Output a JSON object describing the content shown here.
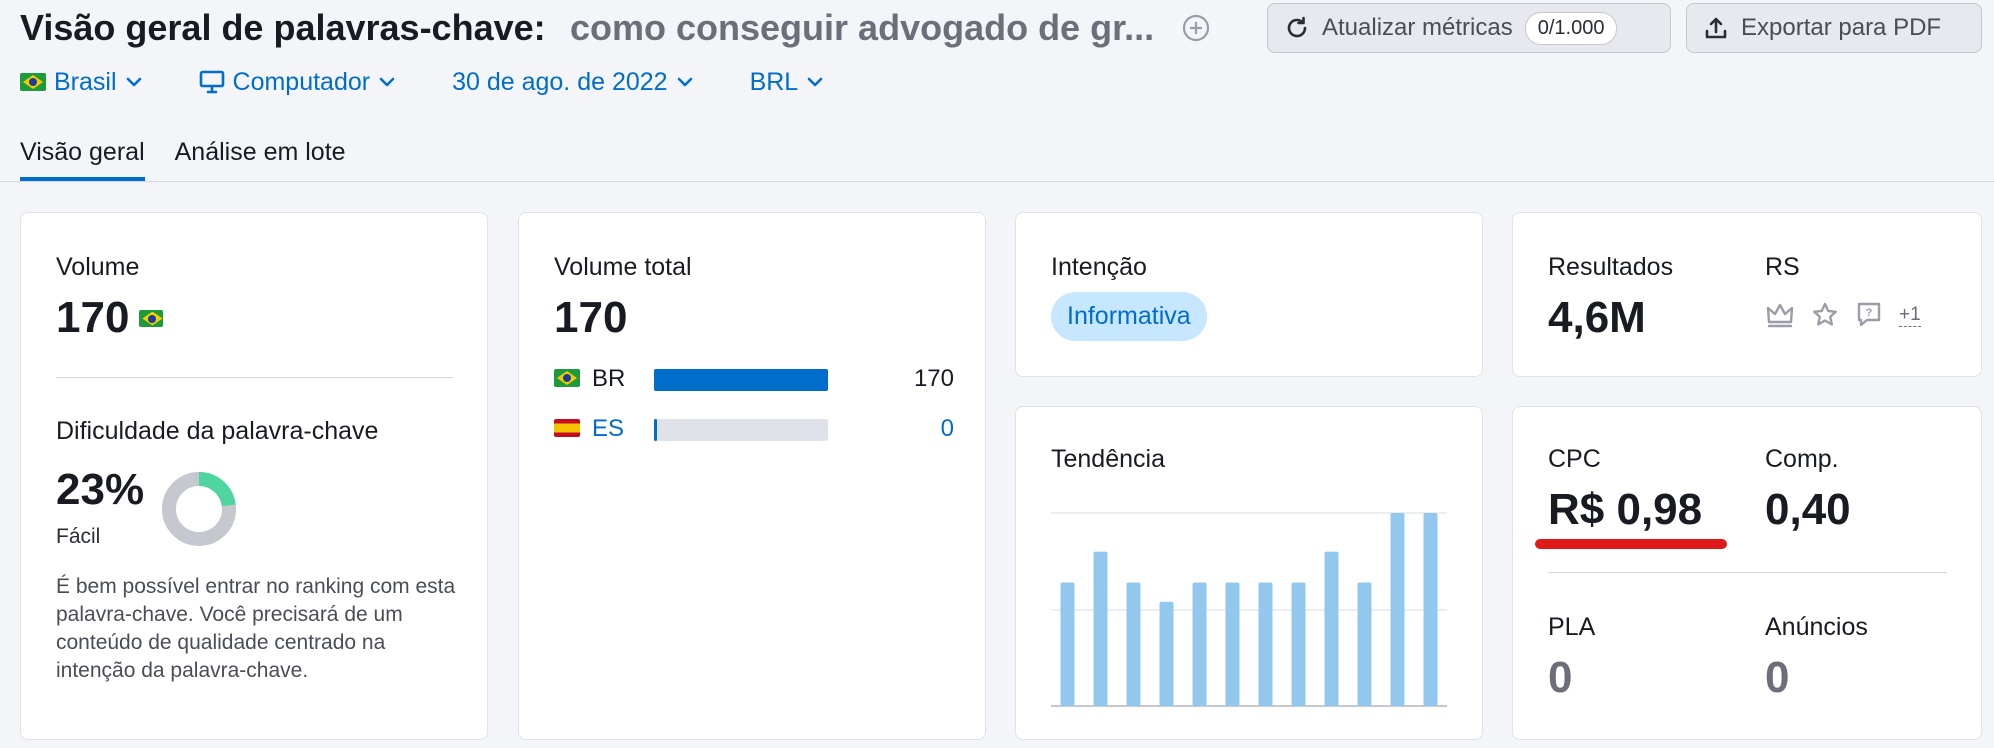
{
  "header": {
    "title": "Visão geral de palavras-chave:",
    "keyword": "como conseguir advogado de gr...",
    "refresh_label": "Atualizar métricas",
    "refresh_count": "0/1.000",
    "export_label": "Exportar para PDF"
  },
  "filters": {
    "country": "Brasil",
    "device": "Computador",
    "date": "30 de ago. de 2022",
    "currency": "BRL"
  },
  "tabs": [
    {
      "label": "Visão geral",
      "active": true
    },
    {
      "label": "Análise em lote",
      "active": false
    }
  ],
  "volume": {
    "label": "Volume",
    "value": "170",
    "kd_label": "Dificuldade da palavra-chave",
    "kd_value": "23%",
    "kd_percent": 23,
    "kd_level": "Fácil",
    "kd_description": "É bem possível entrar no ranking com esta palavra-chave. Você precisará de um conteúdo de qualidade centrado na intenção da palavra-chave."
  },
  "total_volume": {
    "label": "Volume total",
    "value": "170",
    "rows": [
      {
        "country": "BR",
        "value": "170",
        "fraction": 1.0
      },
      {
        "country": "ES",
        "value": "0",
        "fraction": 0.02
      }
    ]
  },
  "intent": {
    "label": "Intenção",
    "value": "Informativa"
  },
  "results": {
    "label": "Resultados",
    "value": "4,6M",
    "serp_label": "RS",
    "serp_extra": "+1",
    "serp_icons": [
      "crown-icon",
      "star-icon",
      "question-bubble-icon"
    ]
  },
  "trend": {
    "label": "Tendência",
    "values": [
      0.64,
      0.8,
      0.64,
      0.54,
      0.64,
      0.64,
      0.64,
      0.64,
      0.8,
      0.64,
      1.0,
      1.0
    ]
  },
  "cpc": {
    "cpc_label": "CPC",
    "cpc_value": "R$ 0,98",
    "comp_label": "Comp.",
    "comp_value": "0,40",
    "pla_label": "PLA",
    "pla_value": "0",
    "ads_label": "Anúncios",
    "ads_value": "0"
  },
  "colors": {
    "accent": "#006dca",
    "bar": "#93c8ee",
    "kd_easy": "#4fd6a0",
    "highlight": "#e01a1a"
  }
}
